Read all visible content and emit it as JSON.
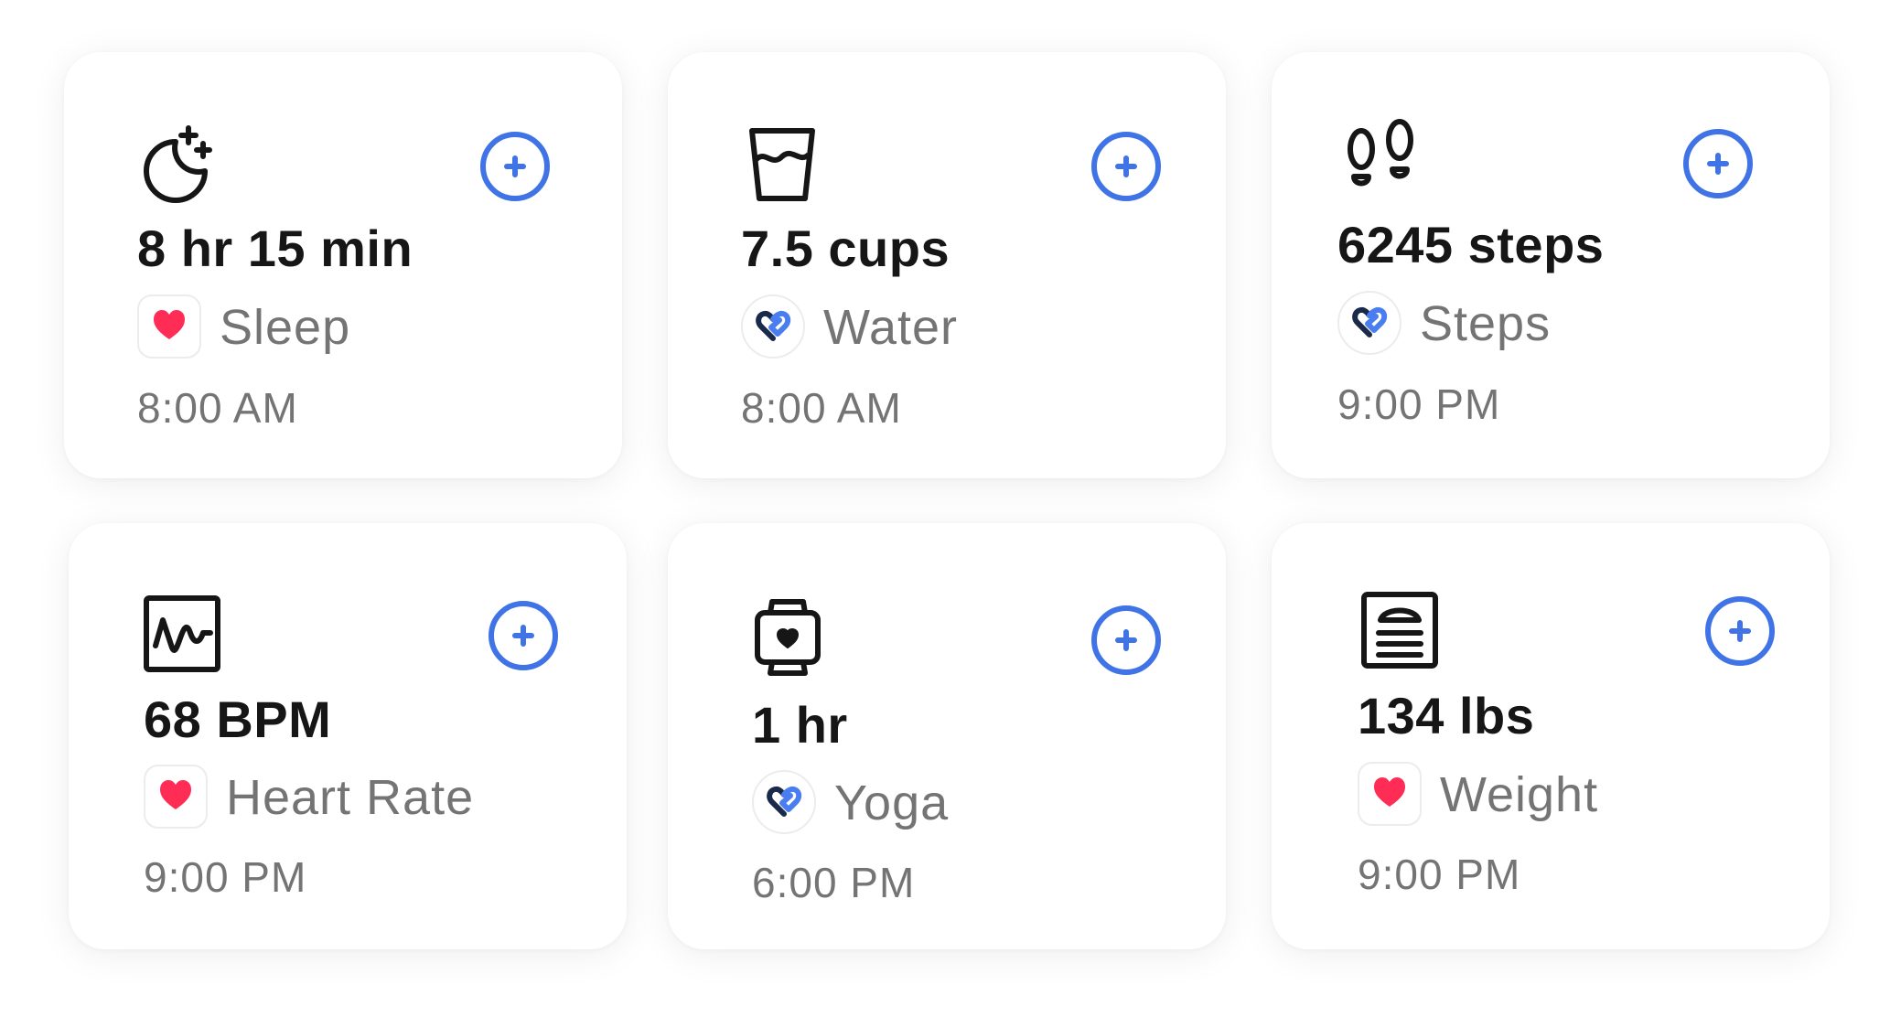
{
  "cards": [
    {
      "value": "8 hr 15 min",
      "source": "Sleep",
      "time": "8:00 AM",
      "icon": "moon-stars-icon",
      "app": "apple-health"
    },
    {
      "value": "7.5 cups",
      "source": "Water",
      "time": "8:00 AM",
      "icon": "water-glass-icon",
      "app": "google-fit"
    },
    {
      "value": "6245 steps",
      "source": "Steps",
      "time": "9:00 PM",
      "icon": "footprints-icon",
      "app": "google-fit"
    },
    {
      "value": "68 BPM",
      "source": "Heart Rate",
      "time": "9:00 PM",
      "icon": "heart-rate-monitor-icon",
      "app": "apple-health"
    },
    {
      "value": "1 hr",
      "source": "Yoga",
      "time": "6:00 PM",
      "icon": "smartwatch-heart-icon",
      "app": "google-fit"
    },
    {
      "value": "134 lbs",
      "source": "Weight",
      "time": "9:00 PM",
      "icon": "weight-scale-icon",
      "app": "apple-health"
    }
  ],
  "colors": {
    "accent": "#3f73e6",
    "health_heart": "#ff2d55",
    "text_primary": "#161616",
    "text_secondary": "#747474"
  }
}
